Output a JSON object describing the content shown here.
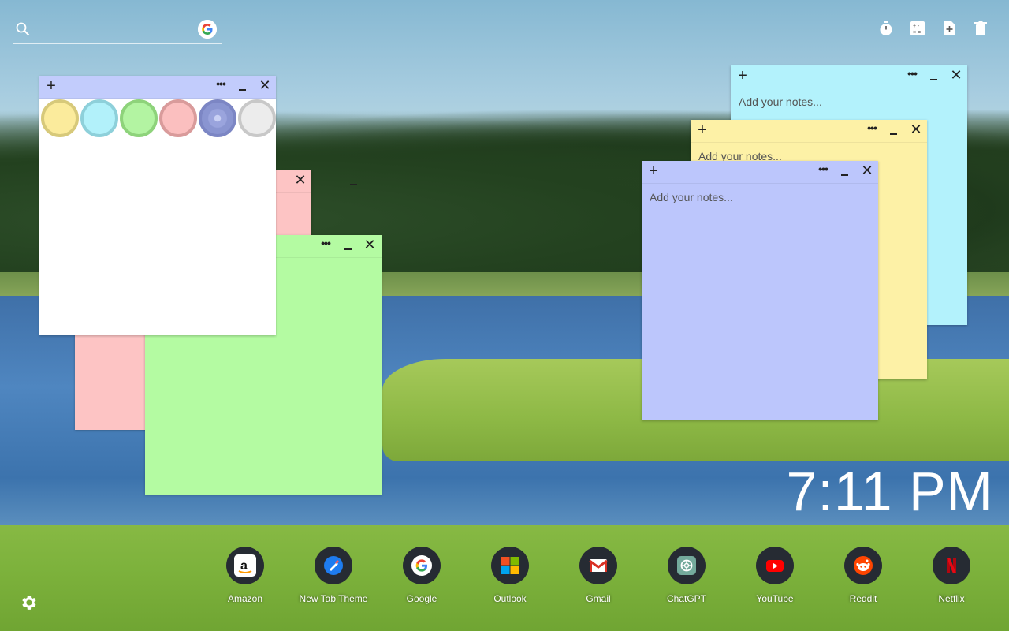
{
  "search": {
    "placeholder": ""
  },
  "tools": [
    {
      "icon": "timer-icon"
    },
    {
      "icon": "calculator-icon"
    },
    {
      "icon": "new-note-icon"
    },
    {
      "icon": "trash-icon"
    }
  ],
  "notes": {
    "palette_note": {
      "swatches": [
        "#fbeb9c",
        "#b2f1fa",
        "#b3f4a2",
        "#fbbfbf",
        "#aeb6ea",
        "#ececec"
      ]
    },
    "cyan": {
      "placeholder": "Add your notes..."
    },
    "yellow": {
      "placeholder": "Add your notes..."
    },
    "purple": {
      "placeholder": "Add your notes..."
    }
  },
  "clock": {
    "time": "7:11 PM"
  },
  "shortcuts": [
    {
      "label": "Amazon"
    },
    {
      "label": "New Tab Theme"
    },
    {
      "label": "Google"
    },
    {
      "label": "Outlook"
    },
    {
      "label": "Gmail"
    },
    {
      "label": "ChatGPT"
    },
    {
      "label": "YouTube"
    },
    {
      "label": "Reddit"
    },
    {
      "label": "Netflix"
    }
  ],
  "colors": {
    "pink_note": "#fdc4c4",
    "green_note": "#b4fba2",
    "cyan_note": "#b3f2fc",
    "yellow_note": "#fdf1a6",
    "purple_note": "#bcc6fc"
  }
}
